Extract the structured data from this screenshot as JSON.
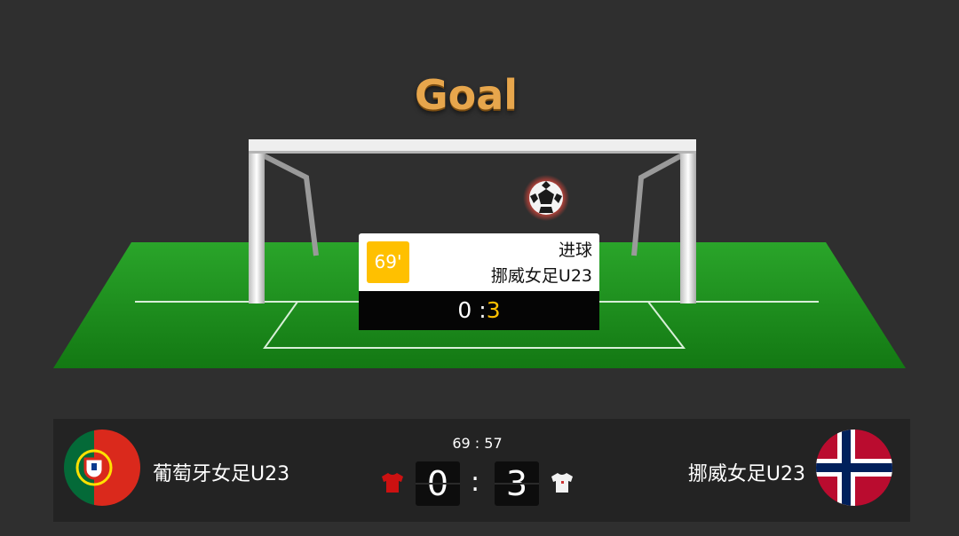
{
  "headline": "Goal",
  "event": {
    "minute": "69'",
    "type": "进球",
    "team": "挪威女足U23",
    "score_home": "0",
    "score_sep": ":",
    "score_away": "3"
  },
  "match": {
    "clock": "69 : 57",
    "home": {
      "name": "葡萄牙女足U23",
      "score": "0",
      "shirt_color": "#cc1111"
    },
    "separator": ":",
    "away": {
      "name": "挪威女足U23",
      "score": "3",
      "shirt_color": "#f2f2f2"
    }
  },
  "colors": {
    "background": "#2f2f2f",
    "pitch": "#1f8f1f",
    "accent": "#ffc000",
    "headline": "#e7a64c"
  },
  "icons": {
    "ball": "soccer-ball-icon",
    "home_flag": "portugal-flag-icon",
    "away_flag": "norway-flag-icon",
    "home_shirt": "red-shirt-icon",
    "away_shirt": "white-shirt-icon"
  }
}
